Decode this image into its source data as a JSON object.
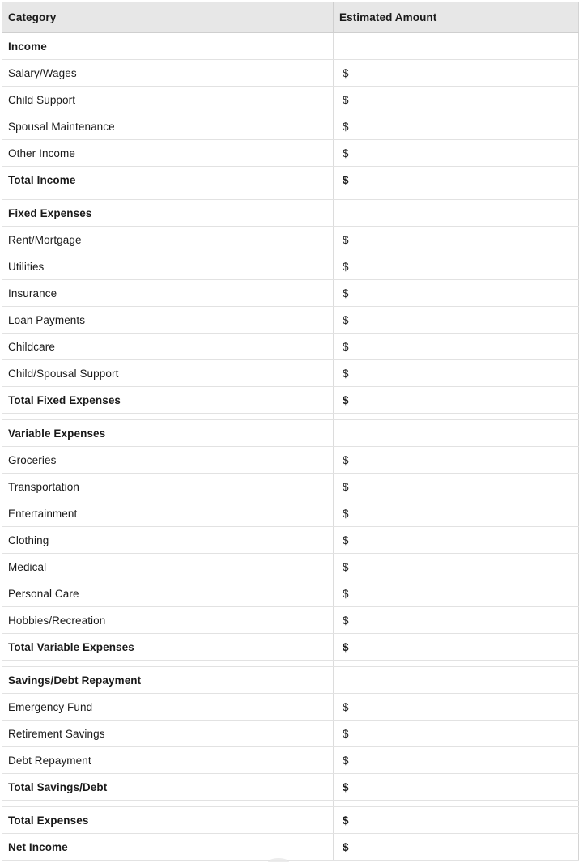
{
  "table": {
    "columns": [
      {
        "key": "category",
        "label": "Category"
      },
      {
        "key": "amount",
        "label": "Estimated Amount"
      }
    ],
    "amount_placeholder": "$",
    "colors": {
      "header_background": "#e7e7e7",
      "page_background": "#ffffff",
      "text": "#1a1a1a",
      "row_border": "#e2e2e2",
      "table_border": "#d4d4d4"
    },
    "rows": [
      {
        "category": "Income",
        "amount": "",
        "emphasis": true,
        "type": "section"
      },
      {
        "category": "Salary/Wages",
        "amount": "$",
        "emphasis": false,
        "type": "item"
      },
      {
        "category": "Child Support",
        "amount": "$",
        "emphasis": false,
        "type": "item"
      },
      {
        "category": "Spousal Maintenance",
        "amount": "$",
        "emphasis": false,
        "type": "item"
      },
      {
        "category": "Other Income",
        "amount": "$",
        "emphasis": false,
        "type": "item"
      },
      {
        "category": "Total Income",
        "amount": "$",
        "emphasis": true,
        "type": "total"
      },
      {
        "category": "",
        "amount": "",
        "emphasis": false,
        "type": "spacer"
      },
      {
        "category": "Fixed Expenses",
        "amount": "",
        "emphasis": true,
        "type": "section"
      },
      {
        "category": "Rent/Mortgage",
        "amount": "$",
        "emphasis": false,
        "type": "item"
      },
      {
        "category": "Utilities",
        "amount": "$",
        "emphasis": false,
        "type": "item"
      },
      {
        "category": "Insurance",
        "amount": "$",
        "emphasis": false,
        "type": "item"
      },
      {
        "category": "Loan Payments",
        "amount": "$",
        "emphasis": false,
        "type": "item"
      },
      {
        "category": "Childcare",
        "amount": "$",
        "emphasis": false,
        "type": "item"
      },
      {
        "category": "Child/Spousal Support",
        "amount": "$",
        "emphasis": false,
        "type": "item"
      },
      {
        "category": "Total Fixed Expenses",
        "amount": "$",
        "emphasis": true,
        "type": "total"
      },
      {
        "category": "",
        "amount": "",
        "emphasis": false,
        "type": "spacer"
      },
      {
        "category": "Variable Expenses",
        "amount": "",
        "emphasis": true,
        "type": "section"
      },
      {
        "category": "Groceries",
        "amount": "$",
        "emphasis": false,
        "type": "item"
      },
      {
        "category": "Transportation",
        "amount": "$",
        "emphasis": false,
        "type": "item"
      },
      {
        "category": "Entertainment",
        "amount": "$",
        "emphasis": false,
        "type": "item"
      },
      {
        "category": "Clothing",
        "amount": "$",
        "emphasis": false,
        "type": "item"
      },
      {
        "category": "Medical",
        "amount": "$",
        "emphasis": false,
        "type": "item"
      },
      {
        "category": "Personal Care",
        "amount": "$",
        "emphasis": false,
        "type": "item"
      },
      {
        "category": "Hobbies/Recreation",
        "amount": "$",
        "emphasis": false,
        "type": "item"
      },
      {
        "category": "Total Variable Expenses",
        "amount": "$",
        "emphasis": true,
        "type": "total"
      },
      {
        "category": "",
        "amount": "",
        "emphasis": false,
        "type": "spacer"
      },
      {
        "category": "Savings/Debt Repayment",
        "amount": "",
        "emphasis": true,
        "type": "section"
      },
      {
        "category": "Emergency Fund",
        "amount": "$",
        "emphasis": false,
        "type": "item"
      },
      {
        "category": "Retirement Savings",
        "amount": "$",
        "emphasis": false,
        "type": "item"
      },
      {
        "category": "Debt Repayment",
        "amount": "$",
        "emphasis": false,
        "type": "item"
      },
      {
        "category": "Total Savings/Debt",
        "amount": "$",
        "emphasis": true,
        "type": "total"
      },
      {
        "category": "",
        "amount": "",
        "emphasis": false,
        "type": "spacer"
      },
      {
        "category": "Total Expenses",
        "amount": "$",
        "emphasis": true,
        "type": "total"
      },
      {
        "category": "Net Income",
        "amount": "$",
        "emphasis": true,
        "type": "total"
      }
    ]
  }
}
